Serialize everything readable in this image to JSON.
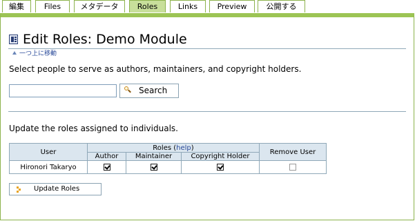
{
  "tabs": [
    {
      "label": "編集",
      "active": false
    },
    {
      "label": "Files",
      "active": false
    },
    {
      "label": "メタデータ",
      "active": false
    },
    {
      "label": "Roles",
      "active": true
    },
    {
      "label": "Links",
      "active": false
    },
    {
      "label": "Preview",
      "active": false
    },
    {
      "label": "公開する",
      "active": false
    }
  ],
  "page": {
    "title": "Edit Roles: Demo Module",
    "up_link": "一つ上に移動",
    "intro": "Select people to serve as authors, maintainers, and copyright holders.",
    "update_intro": "Update the roles assigned to individuals."
  },
  "search": {
    "value": "",
    "button_label": "Search",
    "icon": "magnifier-icon"
  },
  "roles_table": {
    "user_header": "User",
    "roles_header": "Roles",
    "roles_help_open": " (",
    "roles_help_link": "help",
    "roles_help_close": ")",
    "remove_header": "Remove User",
    "columns": [
      "Author",
      "Maintainer",
      "Copyright Holder"
    ],
    "rows": [
      {
        "user": "Hironori Takaryo",
        "author": true,
        "maintainer": true,
        "copyright_holder": true,
        "remove": false
      }
    ]
  },
  "update_button": {
    "label": "Update Roles",
    "icon": "arrow-icon"
  },
  "colors": {
    "tab_border": "#8cb24c",
    "tab_active": "#c8df9b",
    "frame_top": "#9cc454",
    "table_header": "#dbe6ef",
    "link": "#2a4a9a"
  }
}
